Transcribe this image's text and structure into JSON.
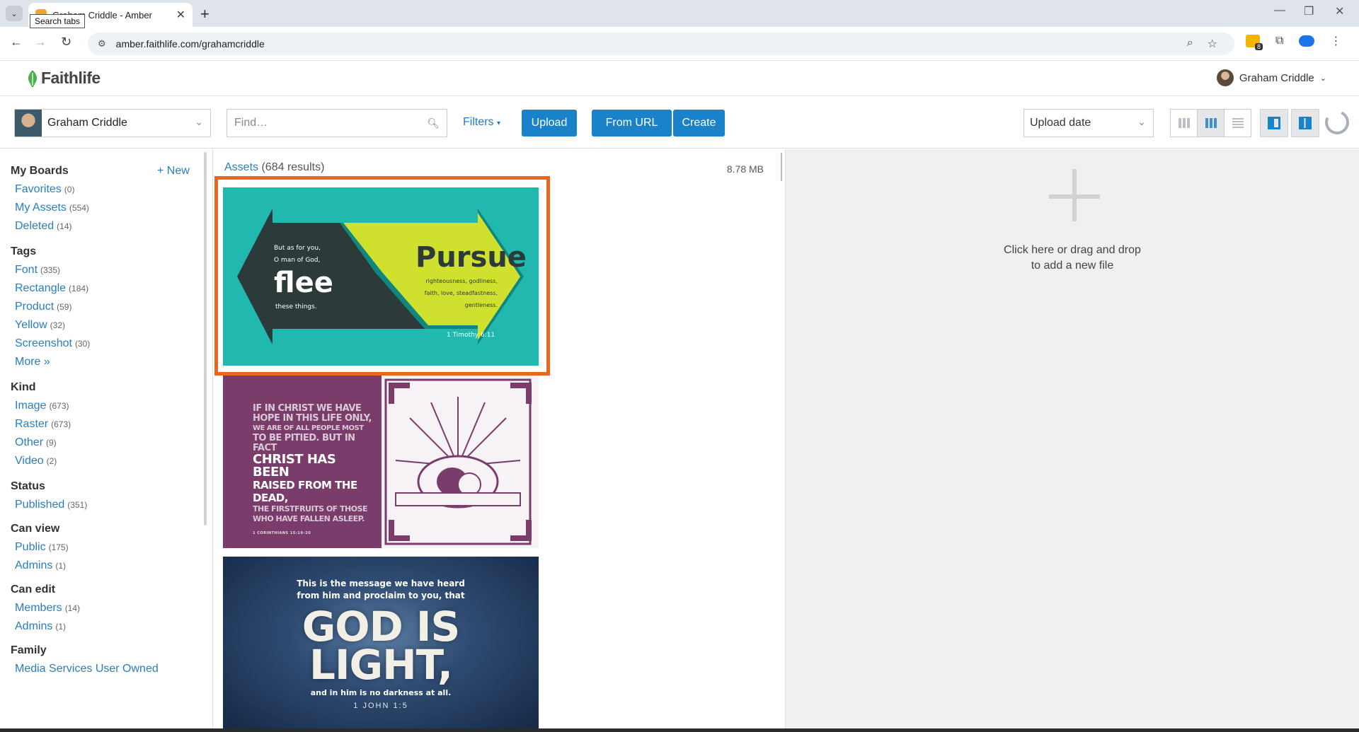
{
  "browser": {
    "tab_title": "Graham Criddle - Amber",
    "tooltip": "Search tabs",
    "url": "amber.faithlife.com/grahamcriddle",
    "extension_badge": "8"
  },
  "app": {
    "logo": "Faithlife",
    "user_name": "Graham Criddle"
  },
  "toolbar": {
    "owner": "Graham Criddle",
    "search_placeholder": "Find…",
    "filters_label": "Filters",
    "upload_label": "Upload",
    "from_url_label": "From URL",
    "create_label": "Create",
    "sort_value": "Upload date"
  },
  "sidebar": {
    "new_label": "+ New",
    "sections": [
      {
        "title": "My Boards",
        "items": [
          {
            "label": "Favorites",
            "count": "(0)"
          },
          {
            "label": "My Assets",
            "count": "(554)"
          },
          {
            "label": "Deleted",
            "count": "(14)"
          }
        ]
      },
      {
        "title": "Tags",
        "items": [
          {
            "label": "Font",
            "count": "(335)"
          },
          {
            "label": "Rectangle",
            "count": "(184)"
          },
          {
            "label": "Product",
            "count": "(59)"
          },
          {
            "label": "Yellow",
            "count": "(32)"
          },
          {
            "label": "Screenshot",
            "count": "(30)"
          },
          {
            "label": "More »",
            "count": ""
          }
        ]
      },
      {
        "title": "Kind",
        "items": [
          {
            "label": "Image",
            "count": "(673)"
          },
          {
            "label": "Raster",
            "count": "(673)"
          },
          {
            "label": "Other",
            "count": "(9)"
          },
          {
            "label": "Video",
            "count": "(2)"
          }
        ]
      },
      {
        "title": "Status",
        "items": [
          {
            "label": "Published",
            "count": "(351)"
          }
        ]
      },
      {
        "title": "Can view",
        "items": [
          {
            "label": "Public",
            "count": "(175)"
          },
          {
            "label": "Admins",
            "count": "(1)"
          }
        ]
      },
      {
        "title": "Can edit",
        "items": [
          {
            "label": "Members",
            "count": "(14)"
          },
          {
            "label": "Admins",
            "count": "(1)"
          }
        ]
      },
      {
        "title": "Family",
        "items": [
          {
            "label": "Media Services User Owned",
            "count": ""
          }
        ]
      }
    ]
  },
  "assets": {
    "link": "Assets",
    "results": "(684 results)",
    "size": "8.78 MB",
    "card1": {
      "left_small": [
        "But as for you,",
        "O man of God,"
      ],
      "left_big": "flee",
      "left_tail": "these things.",
      "right_big": "Pursue",
      "right_small": [
        "righteousness, godliness,",
        "faith, love, steadfastness,",
        "gentleness."
      ],
      "ref": "1 Timothy 6:11"
    },
    "card2": {
      "lines_small1": [
        "IF IN CHRIST WE HAVE",
        "HOPE IN THIS LIFE ONLY,",
        "WE ARE OF ALL PEOPLE MOST",
        "TO BE PITIED. BUT IN FACT"
      ],
      "lines_big": [
        "CHRIST HAS BEEN",
        "RAISED FROM THE DEAD,"
      ],
      "lines_small2": [
        "THE FIRSTFRUITS OF THOSE",
        "WHO HAVE FALLEN ASLEEP."
      ],
      "ref": "1 CORINTHIANS 15:19–20"
    },
    "card3": {
      "top": [
        "This is the message we have heard",
        "from him and proclaim to you, that"
      ],
      "big1": "GOD IS",
      "big2": "LIGHT,",
      "bottom": "and in him is no darkness at all.",
      "ref": "1 JOHN 1:5"
    }
  },
  "drop": {
    "line1": "Click here or drag and drop",
    "line2": "to add a new file"
  }
}
